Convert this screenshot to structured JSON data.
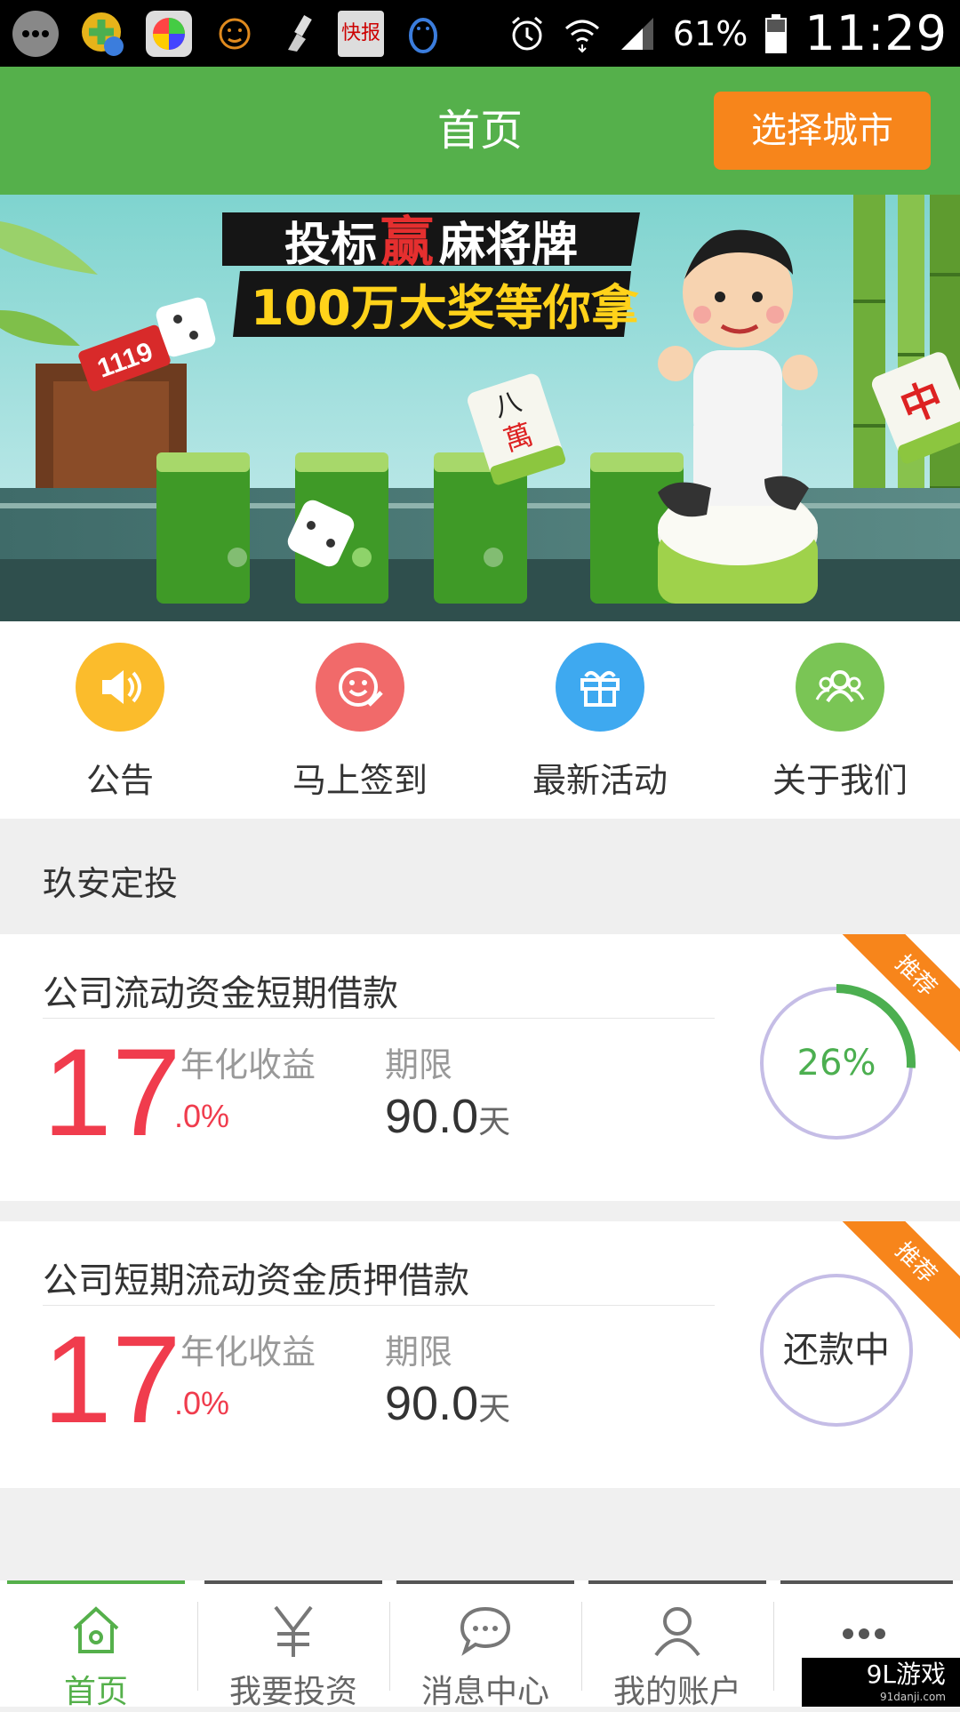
{
  "status_bar": {
    "battery": "61%",
    "time": "11:29",
    "notification_icons": [
      "chat-bubble-icon",
      "green-plus-mail-icon",
      "color-wheel-icon",
      "face-icon",
      "brush-icon",
      "kuaibao-icon",
      "qq-penguin-icon"
    ],
    "notification_label": "快报",
    "system_icons": [
      "alarm-icon",
      "wifi-icon",
      "signal-icon",
      "battery-icon"
    ]
  },
  "header": {
    "title": "首页",
    "city_button": "选择城市",
    "bg_color": "#55b04b",
    "button_color": "#f7851b"
  },
  "banner": {
    "headline_part1": "投标",
    "headline_highlight": "赢",
    "headline_part2": "麻将牌",
    "subline": "100万大奖等你拿",
    "badge_text": "1119",
    "tile_left_top": "八",
    "tile_left_bottom": "萬",
    "tile_right": "中",
    "dots": 3,
    "active_dot": 2
  },
  "quick_menu": [
    {
      "label": "公告",
      "icon": "speaker-icon",
      "color": "#fbbc2c"
    },
    {
      "label": "马上签到",
      "icon": "smile-pen-icon",
      "color": "#f16a6a"
    },
    {
      "label": "最新活动",
      "icon": "gift-icon",
      "color": "#3ea9f0"
    },
    {
      "label": "关于我们",
      "icon": "group-icon",
      "color": "#7ac555"
    }
  ],
  "section": {
    "title": "玖安定投"
  },
  "products": [
    {
      "name": "公司流动资金短期借款",
      "rate_integer": "17",
      "rate_decimal": ".0%",
      "rate_label": "年化收益",
      "term_label": "期限",
      "term_value": "90.0",
      "term_unit": "天",
      "progress_text": "26%",
      "progress": 0.26,
      "ribbon": "推荐"
    },
    {
      "name": "公司短期流动资金质押借款",
      "rate_integer": "17",
      "rate_decimal": ".0%",
      "rate_label": "年化收益",
      "term_label": "期限",
      "term_value": "90.0",
      "term_unit": "天",
      "progress_text": "还款中",
      "progress": 0,
      "ribbon": "推荐"
    }
  ],
  "tab_bar": [
    {
      "label": "首页",
      "icon": "home-icon",
      "active": true
    },
    {
      "label": "我要投资",
      "icon": "yen-icon",
      "active": false
    },
    {
      "label": "消息中心",
      "icon": "message-icon",
      "active": false
    },
    {
      "label": "我的账户",
      "icon": "person-icon",
      "active": false
    },
    {
      "label": "",
      "icon": "more-icon",
      "active": false
    }
  ],
  "watermark": {
    "text": "9L游戏",
    "url_text": "91danji.com"
  },
  "colors": {
    "accent_green": "#55b04b",
    "orange": "#f7851b",
    "rate_red": "#f03c4d",
    "ring_purple": "#c5bde6"
  }
}
